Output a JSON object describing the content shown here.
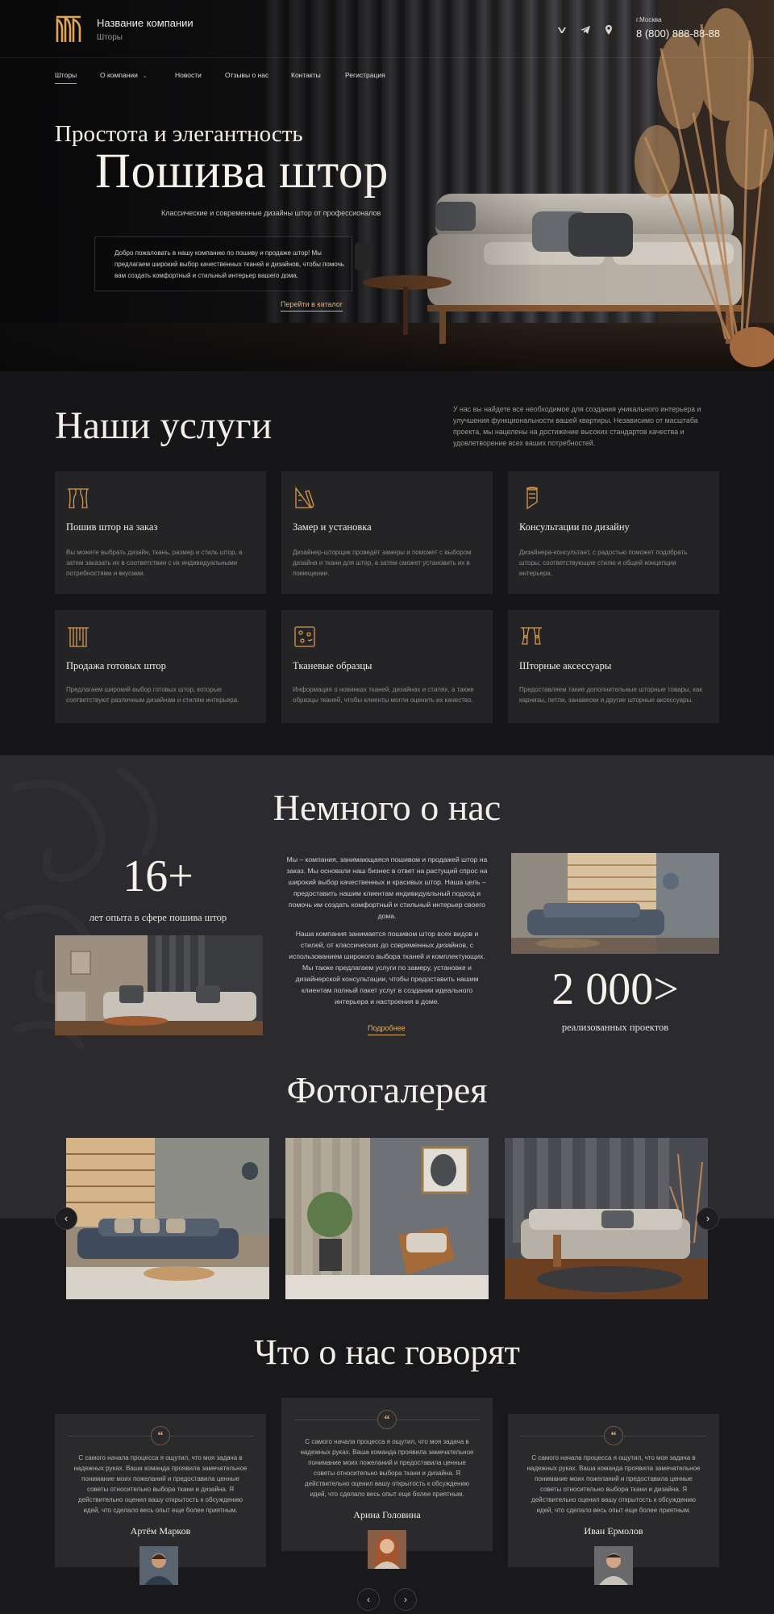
{
  "header": {
    "company_name": "Название компании",
    "company_sub": "Шторы",
    "city": "г.Москва",
    "phone": "8 (800) 888-88-88",
    "social_icons": [
      "vk-icon",
      "telegram-icon",
      "location-icon"
    ]
  },
  "nav": {
    "items": [
      {
        "label": "Шторы",
        "active": true
      },
      {
        "label": "О компании",
        "active": false,
        "dropdown": true
      },
      {
        "label": "Новости",
        "active": false
      },
      {
        "label": "Отзывы о нас",
        "active": false
      },
      {
        "label": "Контакты",
        "active": false
      },
      {
        "label": "Регистрация",
        "active": false
      }
    ]
  },
  "hero": {
    "pre_title": "Простота и элегантность",
    "title": "Пошива штор",
    "subtitle": "Классические и современные дизайны штор от профессионалов",
    "intro": "Добро пожаловать в нашу компанию по пошиву и продаже штор! Мы предлагаем широкий выбор качественных тканей и дизайнов, чтобы помочь вам создать комфортный и стильный интерьер вашего дома.",
    "cta": "Перейти в каталог"
  },
  "services": {
    "title": "Наши услуги",
    "intro": "У нас вы найдете все необходимое для создания уникального интерьера и улучшения функциональности вашей квартиры. Независимо от масштаба проекта, мы нацелены на достижение высоких стандартов качества и удовлетворение всех ваших потребностей.",
    "items": [
      {
        "title": "Пошив штор на заказ",
        "text": "Вы можете выбрать дизайн, ткань, размер и стиль штор, а затем заказать их в соответствии с их индивидуальными потребностями и вкусами.",
        "icon": "curtain-icon"
      },
      {
        "title": "Замер и установка",
        "text": "Дизайнер-шторщик проведёт замеры и поможет с выбором дизайна и ткани для штор, а затем сможет установить их в помещении.",
        "icon": "ruler-pencil-icon"
      },
      {
        "title": "Консультации по дизайну",
        "text": "Дизайнера-консультант, с радостью поможет подобрать шторы, соответствующие стилю и общей концепции интерьера.",
        "icon": "fabric-roll-icon"
      },
      {
        "title": "Продажа готовых штор",
        "text": "Предлагаем широкий выбор готовых штор, которые соответствуют различным дизайнам и стилям интерьера.",
        "icon": "curtain-rod-icon"
      },
      {
        "title": "Тканевые образцы",
        "text": "Информация о новинках тканей, дизайнах и стилях, а также образцы тканей, чтобы клиенты могли оценить их качество.",
        "icon": "fabric-sample-icon"
      },
      {
        "title": "Шторные аксессуары",
        "text": "Предоставляем такие дополнительные шторные товары, как карнизы, петли, занавески и другие шторные аксессуары.",
        "icon": "tieback-icon"
      }
    ]
  },
  "about": {
    "title": "Немного о нас",
    "stat1_value": "16+",
    "stat1_label": "лет опыта в сфере пошива штор",
    "stat2_value": "2 000>",
    "stat2_label": "реализованных проектов",
    "para1": "Мы – компания, занимающаяся пошивом и продажей штор на заказ. Мы основали наш бизнес в ответ на растущий спрос на широкий выбор качественных и красивых штор. Наша цель – предоставить нашим клиентам индивидуальный подход и помочь им создать комфортный и стильный интерьер своего дома.",
    "para2": "Наша компания занимается пошивом штор всех видов и стилей, от классических до современных дизайнов, с использованием широкого выбора тканей и комплектующих. Мы также предлагаем услуги по замеру, установке и дизайнерской консультации, чтобы предоставить нашим клиентам полный пакет услуг в создании идеального интерьера и настроения в доме.",
    "more": "Подробнее"
  },
  "gallery": {
    "title": "Фотогалерея",
    "prev_icon": "chevron-left-icon",
    "next_icon": "chevron-right-icon"
  },
  "reviews": {
    "title": "Что о нас говорят",
    "items": [
      {
        "text": "С самого начала процесса я ощутил, что моя задача в надежных руках. Ваша команда проявила замечательное понимание моих пожеланий и предоставила ценные советы относительно выбора ткани и дизайна. Я действительно оценил вашу открытость к обсуждению идей, что сделало весь опыт еще более приятным.",
        "name": "Артём Марков"
      },
      {
        "text": "С самого начала процесса я ощутил, что моя задача в надежных руках. Ваша команда проявила замечательное понимание моих пожеланий и предоставила ценные советы относительно выбора ткани и дизайна. Я действительно оценил вашу открытость к обсуждению идей, что сделало весь опыт еще более приятным.",
        "name": "Арина Головина"
      },
      {
        "text": "С самого начала процесса я ощутил, что моя задача в надежных руках. Ваша команда проявила замечательное понимание моих пожеланий и предоставила ценные советы относительно выбора ткани и дизайна. Я действительно оценил вашу открытость к обсуждению идей, что сделало весь опыт еще более приятным.",
        "name": "Иван Ермолов"
      }
    ]
  },
  "colors": {
    "accent": "#e7b067",
    "background": "#161618",
    "card": "#242427",
    "about_bg": "#2b2b2f"
  }
}
